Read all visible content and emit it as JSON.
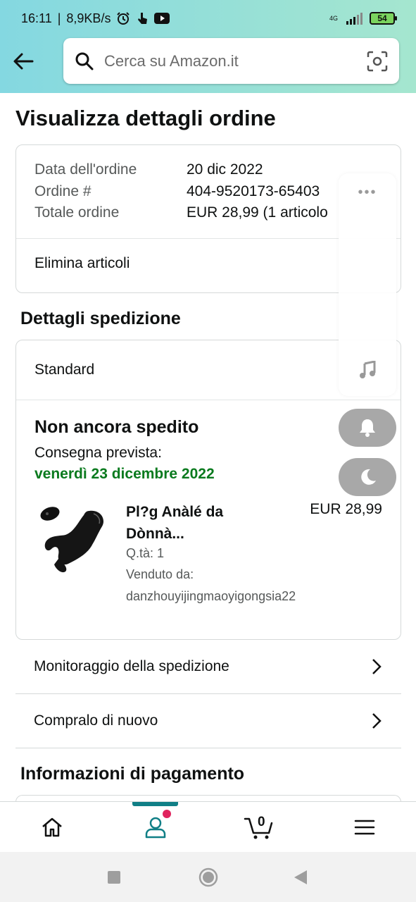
{
  "status_bar": {
    "time": "16:11",
    "net_speed": "8,9KB/s",
    "network_type": "4G",
    "battery": "54"
  },
  "search": {
    "placeholder": "Cerca su Amazon.it"
  },
  "page": {
    "title": "Visualizza dettagli ordine"
  },
  "order_summary": {
    "rows": [
      {
        "label": "Data dell'ordine",
        "value": "20 dic 2022"
      },
      {
        "label": "Ordine #",
        "value": "404-9520173-65403"
      },
      {
        "label": "Totale ordine",
        "value": "EUR 28,99 (1 articolo"
      }
    ],
    "action": "Elimina articoli"
  },
  "shipping": {
    "section_title": "Dettagli spedizione",
    "method": "Standard",
    "status": "Non ancora spedito",
    "delivery_label": "Consegna prevista:",
    "delivery_date": "venerdì 23 dicembre 2022",
    "product": {
      "name_line1": "Pl?g Anàlé da",
      "name_line2": "Dònnà...",
      "price": "EUR 28,99",
      "quantity": "Q.tà: 1",
      "sold_by_label": "Venduto da:",
      "seller": "danzhouyijingmaoyigongsia22"
    }
  },
  "links": [
    {
      "label": "Monitoraggio della spedizione"
    },
    {
      "label": "Compralo di nuovo"
    }
  ],
  "payment": {
    "section_title": "Informazioni di pagamento"
  },
  "bottom_nav": {
    "cart_count": "0"
  },
  "colors": {
    "header_gradient_start": "#84d8e1",
    "header_gradient_end": "#a5e6cf",
    "delivery_green": "#0a7a1e",
    "nav_accent": "#107f86",
    "notification_dot": "#e0245e"
  },
  "icons": [
    "back-arrow-icon",
    "search-icon",
    "camera-scan-icon",
    "more-dots-icon",
    "music-note-icon",
    "bell-icon",
    "moon-icon",
    "home-icon",
    "account-icon",
    "cart-icon",
    "menu-icon",
    "chevron-right-icon"
  ]
}
